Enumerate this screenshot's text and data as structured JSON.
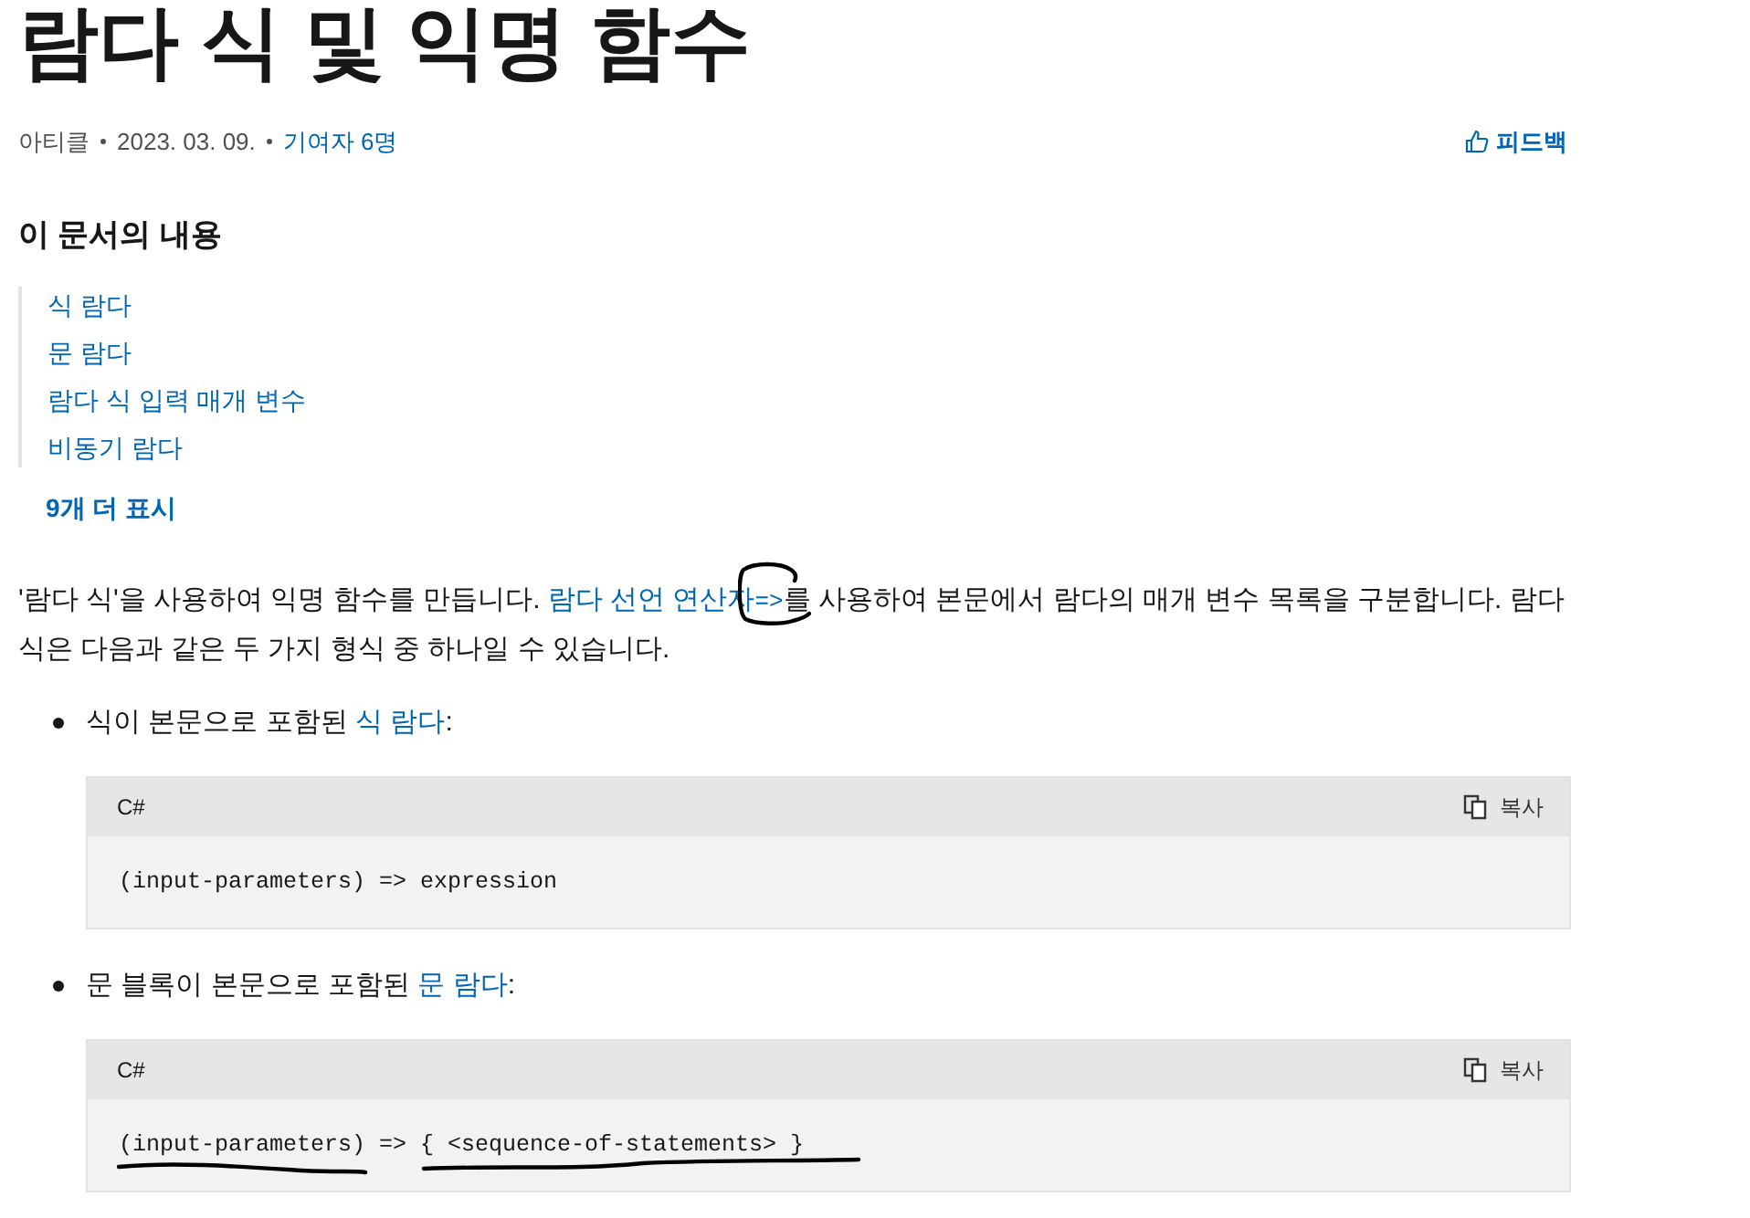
{
  "title": "람다 식 및 익명 함수",
  "meta": {
    "type": "아티클",
    "date": "2023. 03. 09.",
    "contributors": "기여자 6명",
    "feedback": "피드백"
  },
  "toc": {
    "heading": "이 문서의 내용",
    "items": [
      "식 람다",
      "문 람다",
      "람다 식 입력 매개 변수",
      "비동기 람다"
    ],
    "more": "9개 더 표시"
  },
  "intro": [
    {
      "kind": "text",
      "text": "'람다 식'을 사용하여 익명 함수를 만듭니다. "
    },
    {
      "kind": "link",
      "text": "람다 선언 연산자"
    },
    {
      "kind": "code",
      "text": "=>"
    },
    {
      "kind": "text",
      "text": "를 사용하여 본문에서 람다의 매개 변수 목록을 구분합니다. 람다 식은 다음과 같은 두 가지 형식 중 하나일 수 있습니다."
    }
  ],
  "forms": [
    {
      "text": "식이 본문으로 포함된 ",
      "link": "식 람다",
      "suffix": ":",
      "language": "C#",
      "copy": "복사",
      "code": "(input-parameters) => expression"
    },
    {
      "text": "문 블록이 본문으로 포함된 ",
      "link": "문 람다",
      "suffix": ":",
      "language": "C#",
      "copy": "복사",
      "code": "(input-parameters) => { <sequence-of-statements> }"
    }
  ]
}
